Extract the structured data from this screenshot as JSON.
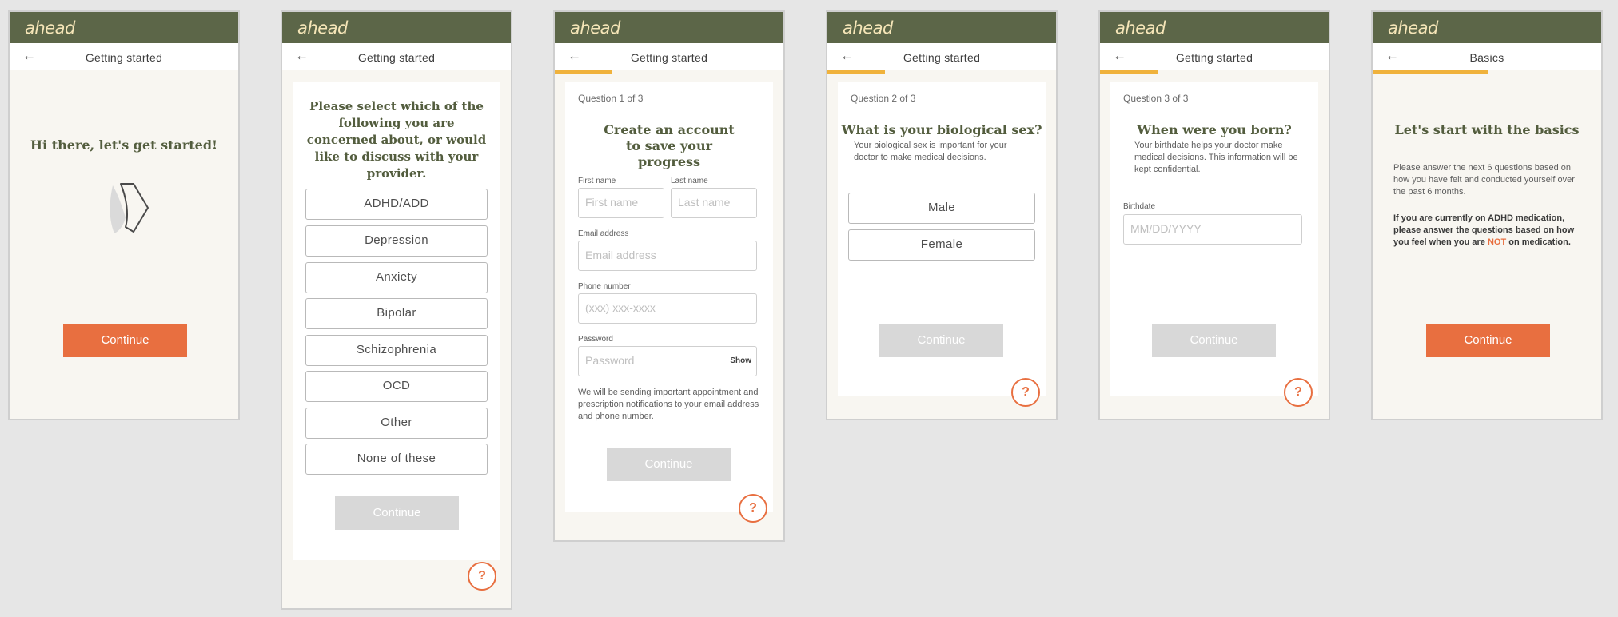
{
  "brand": {
    "logo": "ahead",
    "accent": "#e86f40",
    "header_bg": "#5c6648",
    "progress": "#f0b23c"
  },
  "screens": [
    {
      "title": "Getting started",
      "heading": "Hi there, let's get started!",
      "continue": "Continue"
    },
    {
      "title": "Getting started",
      "heading": "Please select which of the following you are concerned about, or would like to discuss with your provider.",
      "options": [
        "ADHD/ADD",
        "Depression",
        "Anxiety",
        "Bipolar",
        "Schizophrenia",
        "OCD",
        "Other",
        "None of these"
      ],
      "continue": "Continue"
    },
    {
      "title": "Getting started",
      "question": "Question 1 of 3",
      "heading": "Create an account to save your progress",
      "first_name_label": "First name",
      "first_name_placeholder": "First name",
      "last_name_label": "Last name",
      "last_name_placeholder": "Last name",
      "email_label": "Email address",
      "email_placeholder": "Email address",
      "phone_label": "Phone number",
      "phone_placeholder": "(xxx) xxx-xxxx",
      "password_label": "Password",
      "password_placeholder": "Password",
      "show": "Show",
      "notice": "We will be sending important appointment and prescription notifications to your email address and phone number.",
      "continue": "Continue"
    },
    {
      "title": "Getting started",
      "question": "Question 2 of 3",
      "heading": "What is your biological sex?",
      "sub": "Your biological sex is important for your doctor to make medical decisions.",
      "options": [
        "Male",
        "Female"
      ],
      "continue": "Continue"
    },
    {
      "title": "Getting started",
      "question": "Question 3 of 3",
      "heading": "When were you born?",
      "sub": "Your birthdate helps your doctor make medical decisions. This information will be kept confidential.",
      "birth_label": "Birthdate",
      "birth_placeholder": "MM/DD/YYYY",
      "continue": "Continue"
    },
    {
      "title": "Basics",
      "heading": "Let's start with the basics",
      "para1": "Please answer the next 6 questions based on how you have felt and conducted yourself over the past 6 months.",
      "para2_pre": "If you are currently on ADHD medication, please answer the questions based on how you feel when you are ",
      "para2_not": "NOT",
      "para2_post": " on medication.",
      "continue": "Continue"
    }
  ],
  "help": "?",
  "back": "←"
}
